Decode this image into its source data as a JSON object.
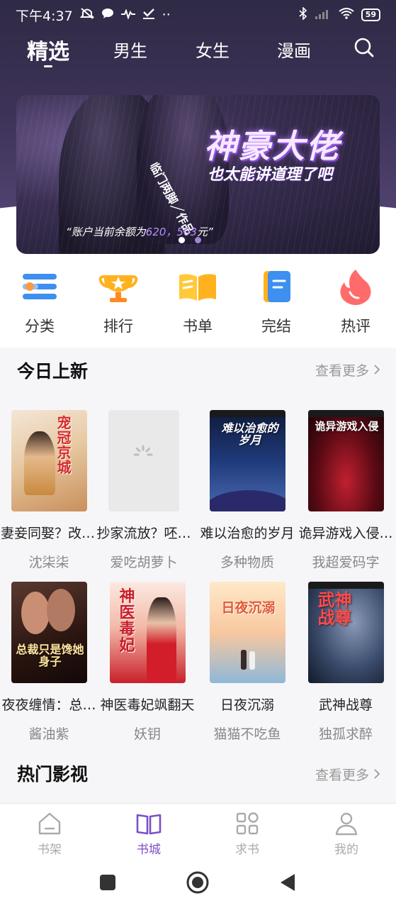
{
  "status_bar": {
    "time": "下午4:37",
    "dots": "··",
    "battery": "59"
  },
  "top_tabs": [
    {
      "label": "精选",
      "active": true
    },
    {
      "label": "男生",
      "active": false
    },
    {
      "label": "女生",
      "active": false
    },
    {
      "label": "漫画",
      "active": false
    }
  ],
  "banner": {
    "title": "神豪大佬",
    "subtitle": "也太能讲道理了吧",
    "side_text": "临门两脚／作品",
    "quote_prefix": "“账户当前余额为",
    "quote_amount": "620，503",
    "quote_suffix": "元”",
    "current_slide": 1,
    "total_slides": 2
  },
  "quick_nav": [
    {
      "label": "分类",
      "icon": "category-icon"
    },
    {
      "label": "排行",
      "icon": "trophy-icon"
    },
    {
      "label": "书单",
      "icon": "booklist-icon"
    },
    {
      "label": "完结",
      "icon": "finished-book-icon"
    },
    {
      "label": "热评",
      "icon": "flame-icon"
    }
  ],
  "today_new": {
    "title": "今日上新",
    "more": "查看更多",
    "books": [
      {
        "title": "妻妾同娶？改嫁…",
        "author": "沈柒柒",
        "cover_text": "宠冠京城"
      },
      {
        "title": "抄家流放？呸…",
        "author": "爱吃胡萝卜",
        "cover_text": ""
      },
      {
        "title": "难以治愈的岁月",
        "author": "多种物质",
        "cover_text": "难以治愈的岁月"
      },
      {
        "title": "诡异游戏入侵…",
        "author": "我超爱码字",
        "cover_text": "诡异游戏入侵"
      },
      {
        "title": "夜夜缠情：总…",
        "author": "酱油紫",
        "cover_text": "总裁只是馋她身子"
      },
      {
        "title": "神医毒妃飒翻天",
        "author": "妖钥",
        "cover_text": "神医毒妃"
      },
      {
        "title": "日夜沉溺",
        "author": "猫猫不吃鱼",
        "cover_text": "日夜沉溺"
      },
      {
        "title": "武神战尊",
        "author": "独孤求醉",
        "cover_text": "武神战尊"
      }
    ]
  },
  "hot_film": {
    "title": "热门影视",
    "more": "查看更多"
  },
  "bottom_nav": [
    {
      "label": "书架",
      "active": false
    },
    {
      "label": "书城",
      "active": true
    },
    {
      "label": "求书",
      "active": false
    },
    {
      "label": "我的",
      "active": false
    }
  ],
  "colors": {
    "accent": "#7b4fc9",
    "header_bg": "#3d3358"
  }
}
